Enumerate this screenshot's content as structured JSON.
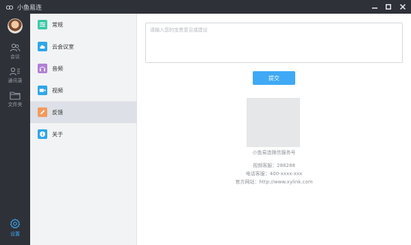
{
  "window": {
    "title": "小鱼易连",
    "logo_glyph": "ꝏ",
    "minimize_icon": "minimize-icon",
    "maximize_icon": "maximize-icon",
    "close_icon": "close-icon"
  },
  "leftnav": {
    "items": [
      {
        "label": "会议",
        "icon": "people-icon"
      },
      {
        "label": "通讯录",
        "icon": "contacts-icon"
      },
      {
        "label": "文件夹",
        "icon": "folder-icon"
      }
    ],
    "settings": {
      "label": "设置",
      "icon": "gear-icon"
    }
  },
  "settings_menu": {
    "items": [
      {
        "label": "常规",
        "icon": "general-icon",
        "color": "#3ec9a7"
      },
      {
        "label": "云会议室",
        "icon": "cloud-icon",
        "color": "#2fa6e6"
      },
      {
        "label": "音频",
        "icon": "headphones-icon",
        "color": "#b07fd6"
      },
      {
        "label": "视频",
        "icon": "video-camera-icon",
        "color": "#2fa6e6"
      },
      {
        "label": "反馈",
        "icon": "pencil-icon",
        "color": "#f39a5d"
      },
      {
        "label": "关于",
        "icon": "info-icon",
        "color": "#2fa6e6"
      }
    ],
    "active_index": 4
  },
  "feedback": {
    "placeholder": "请输入您的宝贵意见或建议",
    "value": "",
    "submit_label": "提交"
  },
  "about": {
    "qr_caption": "小鱼易连微信服务号",
    "video_service": "视频客服：288288",
    "phone_service": "电话客服：400-xxxx-xxx",
    "website": "官方网站：http://www.xylink.com"
  },
  "colors": {
    "accent": "#3fa9f5",
    "nav_bg": "#2e3138"
  }
}
